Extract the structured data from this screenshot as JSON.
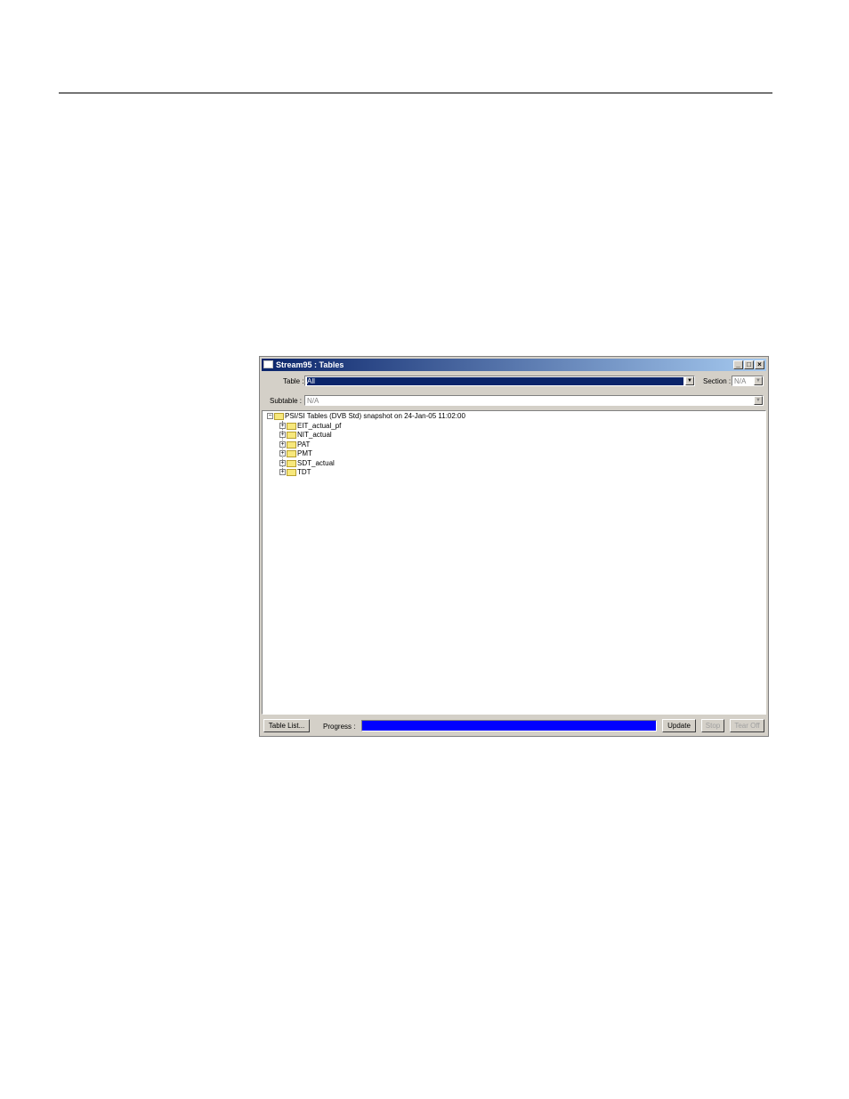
{
  "window": {
    "title": "Stream95 : Tables",
    "controls": {
      "minimize": "_",
      "maximize": "□",
      "close": "×"
    }
  },
  "toolbar": {
    "table_label": "Table :",
    "table_value": "All",
    "section_label": "Section :",
    "section_value": "N/A",
    "subtable_label": "Subtable :",
    "subtable_value": "N/A"
  },
  "tree": {
    "root": {
      "label": "PSI/SI Tables (DVB Std) snapshot on 24-Jan-05 11:02:00",
      "expander": "−",
      "icon": "folder-icon"
    },
    "children": [
      {
        "label": "EIT_actual_pf",
        "expander": "+"
      },
      {
        "label": "NIT_actual",
        "expander": "+"
      },
      {
        "label": "PAT",
        "expander": "+"
      },
      {
        "label": "PMT",
        "expander": "+"
      },
      {
        "label": "SDT_actual",
        "expander": "+"
      },
      {
        "label": "TDT",
        "expander": "+"
      }
    ]
  },
  "footer": {
    "table_list_button": "Table List...",
    "progress_label": "Progress :",
    "progress_fraction": 1.0,
    "update_button": "Update",
    "stop_button": "Stop",
    "tear_off_button": "Tear Off"
  },
  "colors": {
    "title_start": "#0a246a",
    "title_end": "#a6caf0",
    "progress": "#0000ff",
    "window_face": "#d4d0c8"
  }
}
